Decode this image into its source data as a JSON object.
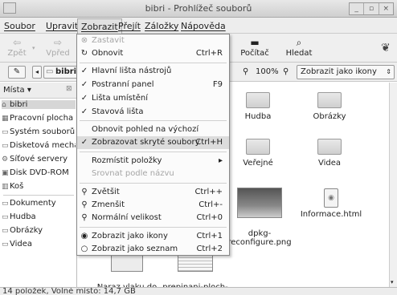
{
  "window": {
    "title": "bibri - Prohlížeč souborů",
    "controls": [
      "_",
      "▫",
      "×"
    ]
  },
  "menubar": [
    "Soubor",
    "Upravit",
    "Zobrazit",
    "Přejít",
    "Záložky",
    "Nápověda"
  ],
  "toolbar": {
    "back": "Zpět",
    "forward": "Vpřed",
    "computer": "Počítač",
    "search": "Hledat"
  },
  "location": {
    "path_button": "bibri",
    "zoom": "100%",
    "view_mode": "Zobrazit jako ikony"
  },
  "sidebar": {
    "header": "Místa",
    "items": [
      "bibri",
      "Pracovní plocha",
      "Systém souborů",
      "Disketová mechanika",
      "Síťové servery",
      "Disk DVD-ROM",
      "Koš",
      "Dokumenty",
      "Hudba",
      "Obrázky",
      "Videa"
    ]
  },
  "files": {
    "row1": [
      "Hudba",
      "Obrázky"
    ],
    "row2": [
      "Veřejné",
      "Videa"
    ],
    "row3": [
      "dpkg-\nreconfigure.png",
      "Informace.html"
    ],
    "row4": [
      "Naraz vlaku do\nauto.wmv",
      "prepinani-ploch-\nzkratky.png"
    ]
  },
  "menu": {
    "stop": "Zastavit",
    "reload": "Obnovit",
    "reload_acc": "Ctrl+R",
    "main_toolbar": "Hlavní lišta nástrojů",
    "side_panel": "Postranní panel",
    "side_panel_acc": "F9",
    "location_bar": "Lišta umístění",
    "status_bar": "Stavová lišta",
    "restore_view": "Obnovit pohled na výchozí",
    "show_hidden": "Zobrazovat skryté soubory",
    "show_hidden_acc": "Ctrl+H",
    "arrange": "Rozmístit položky",
    "arrow": "▸",
    "align_name": "Srovnat podle názvu",
    "zoom_in": "Zvětšit",
    "zoom_in_acc": "Ctrl++",
    "zoom_out": "Zmenšit",
    "zoom_out_acc": "Ctrl+-",
    "normal_size": "Normální velikost",
    "normal_size_acc": "Ctrl+0",
    "as_icons": "Zobrazit jako ikony",
    "as_icons_acc": "Ctrl+1",
    "as_list": "Zobrazit jako seznam",
    "as_list_acc": "Ctrl+2"
  },
  "status": "14 položek, Volné místo: 14,7 GB"
}
